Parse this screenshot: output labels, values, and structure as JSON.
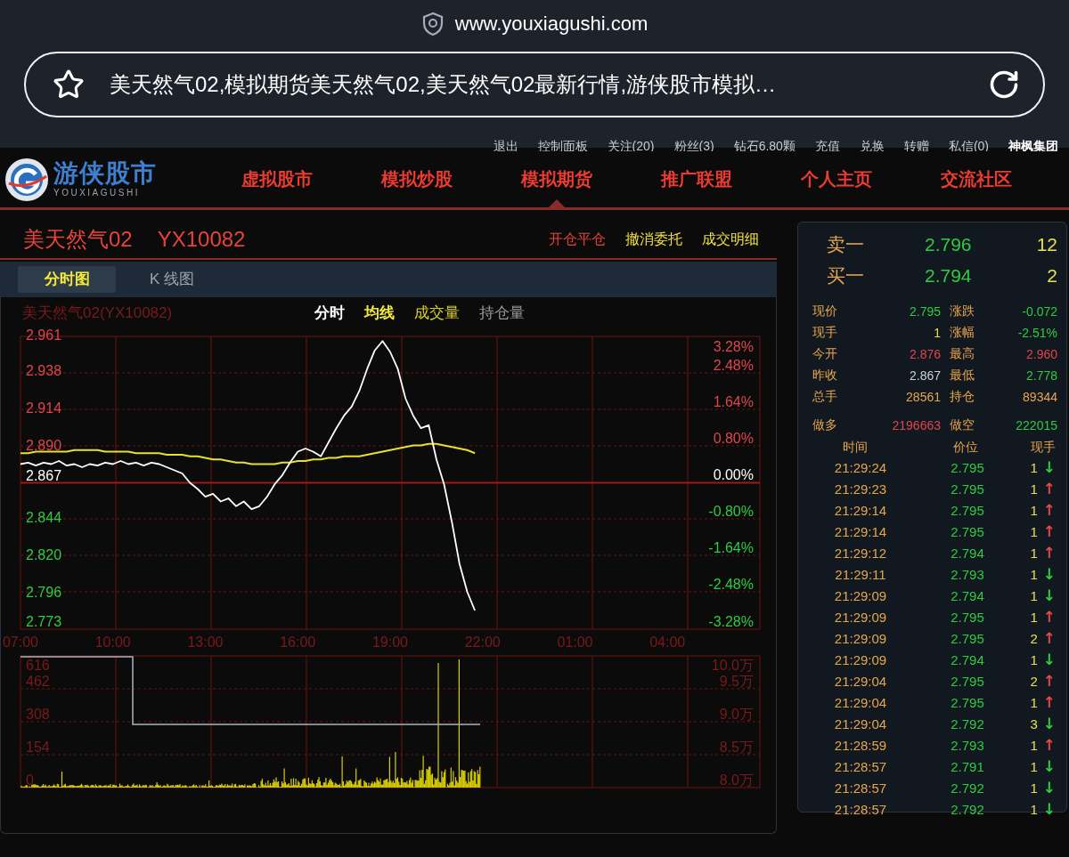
{
  "browser": {
    "url": "www.youxiagushi.com",
    "page_title": "美天然气02,模拟期货美天然气02,美天然气02最新行情,游侠股市模拟…"
  },
  "top_links": [
    {
      "label": "退出",
      "kind": "link"
    },
    {
      "label": "控制面板",
      "kind": "link"
    },
    {
      "label": "关注(20)",
      "kind": "link"
    },
    {
      "label": "粉丝(3)",
      "kind": "link"
    },
    {
      "label": "钻石6.80颗",
      "kind": "link"
    },
    {
      "label": "充值",
      "kind": "link"
    },
    {
      "label": "兑换",
      "kind": "link"
    },
    {
      "label": "转赠",
      "kind": "link"
    },
    {
      "label": "私信(0)",
      "kind": "link"
    },
    {
      "label": "神枫集团",
      "kind": "brand"
    }
  ],
  "logo": {
    "name": "游侠股市",
    "subtitle": "YOUXIAGUSHI"
  },
  "nav": [
    {
      "label": "虚拟股市",
      "selected": false
    },
    {
      "label": "模拟炒股",
      "selected": false
    },
    {
      "label": "模拟期货",
      "selected": true
    },
    {
      "label": "推广联盟",
      "selected": false
    },
    {
      "label": "个人主页",
      "selected": false
    },
    {
      "label": "交流社区",
      "selected": false
    }
  ],
  "instrument": {
    "name": "美天然气02",
    "code": "YX10082"
  },
  "actions": [
    {
      "label": "开仓平仓",
      "kind": "primary"
    },
    {
      "label": "撤消委托",
      "kind": "secondary"
    },
    {
      "label": "成交明细",
      "kind": "secondary"
    }
  ],
  "chart_tabs": [
    {
      "label": "分时图",
      "selected": true
    },
    {
      "label": "K 线图",
      "selected": false
    }
  ],
  "price_chart": {
    "title": "美天然气02(YX10082)",
    "legend": [
      {
        "label": "分时",
        "kind": "price"
      },
      {
        "label": "均线",
        "kind": "average"
      },
      {
        "label": "成交量",
        "kind": "volume"
      },
      {
        "label": "持仓量",
        "kind": "interest"
      }
    ],
    "percent_ticks": [
      {
        "label": "3.28%",
        "color": "#e0454a"
      },
      {
        "label": "2.48%",
        "color": "#e0454a"
      },
      {
        "label": "1.64%",
        "color": "#e0454a"
      },
      {
        "label": "0.80%",
        "color": "#e0454a"
      },
      {
        "label": "0.00%",
        "color": "#ffffff"
      },
      {
        "label": "-0.80%",
        "color": "#2ecc40"
      },
      {
        "label": "-1.64%",
        "color": "#2ecc40"
      },
      {
        "label": "-2.48%",
        "color": "#2ecc40"
      },
      {
        "label": "-3.28%",
        "color": "#2ecc40"
      }
    ],
    "chart_data": {
      "type": "line",
      "ylim": [
        2.773,
        2.961
      ],
      "grid": true,
      "ref_lines": [
        {
          "axis": "y",
          "value": 2.867
        }
      ],
      "yticks": [
        {
          "value": 2.961,
          "label": "2.961"
        },
        {
          "value": 2.938,
          "label": "2.938"
        },
        {
          "value": 2.914,
          "label": "2.914"
        },
        {
          "value": 2.89,
          "label": "2.890"
        },
        {
          "value": 2.867,
          "label": "2.867"
        },
        {
          "value": 2.844,
          "label": "2.844"
        },
        {
          "value": 2.82,
          "label": "2.820"
        },
        {
          "value": 2.796,
          "label": "2.796"
        },
        {
          "value": 2.773,
          "label": "2.773"
        }
      ],
      "categories": [
        "07:00",
        null,
        null,
        null,
        null,
        null,
        null,
        null,
        null,
        null,
        null,
        null,
        "10:00",
        null,
        null,
        null,
        null,
        null,
        null,
        null,
        null,
        null,
        null,
        null,
        "13:00",
        null,
        null,
        null,
        null,
        null,
        null,
        null,
        null,
        null,
        null,
        null,
        "16:00",
        null,
        null,
        null,
        null,
        null,
        null,
        null,
        null,
        null,
        null,
        null,
        "19:00",
        null,
        null,
        null,
        null,
        null,
        null,
        null,
        null,
        null,
        null,
        null,
        "22:00",
        null,
        null,
        null,
        null,
        null,
        null,
        null,
        null,
        null,
        null,
        null,
        "01:00",
        null,
        null,
        null,
        null,
        null,
        null,
        null,
        null,
        null,
        null,
        null,
        "04:00",
        null,
        null,
        null,
        null,
        null,
        null,
        null,
        null,
        null,
        null,
        null
      ],
      "series": [
        {
          "color": "#ffffff",
          "values": [
            2.879,
            2.88,
            2.878,
            2.88,
            2.879,
            2.881,
            2.878,
            2.879,
            2.877,
            2.879,
            2.878,
            2.88,
            2.879,
            2.881,
            2.879,
            2.88,
            2.878,
            2.88,
            2.879,
            2.877,
            2.875,
            2.873,
            2.867,
            2.863,
            2.858,
            2.86,
            2.855,
            2.857,
            2.852,
            2.855,
            2.85,
            2.852,
            2.858,
            2.866,
            2.872,
            2.88,
            2.887,
            2.889,
            2.887,
            2.884,
            2.893,
            2.902,
            2.91,
            2.916,
            2.926,
            2.94,
            2.952,
            2.958,
            2.951,
            2.94,
            2.921,
            2.91,
            2.902,
            2.904,
            2.882,
            2.866,
            2.842,
            2.815,
            2.797,
            2.785,
            null,
            null,
            null,
            null,
            null,
            null,
            null,
            null,
            null,
            null,
            null,
            null,
            null,
            null,
            null,
            null,
            null,
            null,
            null,
            null,
            null,
            null,
            null,
            null,
            null,
            null,
            null,
            null,
            null,
            null,
            null,
            null,
            null,
            null,
            null,
            null
          ]
        },
        {
          "color": "#e8e030",
          "values": [
            2.886,
            2.886,
            2.887,
            2.887,
            2.887,
            2.887,
            2.887,
            2.888,
            2.888,
            2.888,
            2.888,
            2.887,
            2.887,
            2.887,
            2.887,
            2.886,
            2.886,
            2.886,
            2.886,
            2.885,
            2.885,
            2.885,
            2.884,
            2.884,
            2.883,
            2.882,
            2.882,
            2.881,
            2.88,
            2.88,
            2.879,
            2.879,
            2.879,
            2.879,
            2.88,
            2.88,
            2.881,
            2.881,
            2.882,
            2.882,
            2.883,
            2.883,
            2.884,
            2.884,
            2.884,
            2.885,
            2.886,
            2.887,
            2.888,
            2.889,
            2.89,
            2.891,
            2.891,
            2.892,
            2.892,
            2.891,
            2.89,
            2.889,
            2.888,
            2.886,
            null,
            null,
            null,
            null,
            null,
            null,
            null,
            null,
            null,
            null,
            null,
            null,
            null,
            null,
            null,
            null,
            null,
            null,
            null,
            null,
            null,
            null,
            null,
            null,
            null,
            null,
            null,
            null,
            null,
            null,
            null,
            null,
            null,
            null,
            null,
            null
          ]
        }
      ]
    }
  },
  "volume_chart": {
    "volume_ticks": [
      "616",
      "462",
      "308",
      "154",
      "0"
    ],
    "interest_ticks": [
      "10.0万",
      "9.5万",
      "9.0万",
      "8.5万",
      "8.0万"
    ]
  },
  "quote": {
    "book": [
      {
        "label": "卖一",
        "price": "2.796",
        "volume": "12"
      },
      {
        "label": "买一",
        "price": "2.794",
        "volume": "2"
      }
    ],
    "stats": [
      {
        "label": "现价",
        "value": "2.795",
        "color": "#2ecc40"
      },
      {
        "label": "涨跌",
        "value": "-0.072",
        "color": "#2ecc40"
      },
      {
        "label": "现手",
        "value": "1",
        "color": "#e8e04a"
      },
      {
        "label": "涨幅",
        "value": "-2.51%",
        "color": "#2ecc40"
      },
      {
        "label": "今开",
        "value": "2.876",
        "color": "#e0454a"
      },
      {
        "label": "最高",
        "value": "2.960",
        "color": "#e0454a"
      },
      {
        "label": "昨收",
        "value": "2.867",
        "color": "#c9d1dd"
      },
      {
        "label": "最低",
        "value": "2.778",
        "color": "#2ecc40"
      },
      {
        "label": "总手",
        "value": "28561",
        "color": "#e8a64c"
      },
      {
        "label": "持仓",
        "value": "89344",
        "color": "#e8a64c"
      }
    ],
    "positions": [
      {
        "label": "做多",
        "value": "2196663",
        "color": "#e0454a"
      },
      {
        "label": "做空",
        "value": "222015",
        "color": "#2ecc40"
      }
    ]
  },
  "trades": {
    "columns": [
      "时间",
      "价位",
      "现手"
    ],
    "rows": [
      {
        "time": "21:29:24",
        "price": "2.795",
        "volume": "1",
        "arrow": "↓",
        "color": "#2ecc40"
      },
      {
        "time": "21:29:23",
        "price": "2.795",
        "volume": "1",
        "arrow": "↑",
        "color": "#e0454a"
      },
      {
        "time": "21:29:14",
        "price": "2.795",
        "volume": "1",
        "arrow": "↑",
        "color": "#e0454a"
      },
      {
        "time": "21:29:14",
        "price": "2.795",
        "volume": "1",
        "arrow": "↑",
        "color": "#e0454a"
      },
      {
        "time": "21:29:12",
        "price": "2.794",
        "volume": "1",
        "arrow": "↑",
        "color": "#e0454a"
      },
      {
        "time": "21:29:11",
        "price": "2.793",
        "volume": "1",
        "arrow": "↓",
        "color": "#2ecc40"
      },
      {
        "time": "21:29:09",
        "price": "2.794",
        "volume": "1",
        "arrow": "↓",
        "color": "#2ecc40"
      },
      {
        "time": "21:29:09",
        "price": "2.795",
        "volume": "1",
        "arrow": "↑",
        "color": "#e0454a"
      },
      {
        "time": "21:29:09",
        "price": "2.795",
        "volume": "2",
        "arrow": "↑",
        "color": "#e0454a"
      },
      {
        "time": "21:29:09",
        "price": "2.794",
        "volume": "1",
        "arrow": "↓",
        "color": "#2ecc40"
      },
      {
        "time": "21:29:04",
        "price": "2.795",
        "volume": "2",
        "arrow": "↑",
        "color": "#e0454a"
      },
      {
        "time": "21:29:04",
        "price": "2.795",
        "volume": "1",
        "arrow": "↑",
        "color": "#e0454a"
      },
      {
        "time": "21:29:04",
        "price": "2.792",
        "volume": "3",
        "arrow": "↓",
        "color": "#2ecc40"
      },
      {
        "time": "21:28:59",
        "price": "2.793",
        "volume": "1",
        "arrow": "↑",
        "color": "#e0454a"
      },
      {
        "time": "21:28:57",
        "price": "2.791",
        "volume": "1",
        "arrow": "↓",
        "color": "#2ecc40"
      },
      {
        "time": "21:28:57",
        "price": "2.792",
        "volume": "1",
        "arrow": "↓",
        "color": "#2ecc40"
      },
      {
        "time": "21:28:57",
        "price": "2.792",
        "volume": "1",
        "arrow": "↓",
        "color": "#2ecc40"
      }
    ]
  }
}
